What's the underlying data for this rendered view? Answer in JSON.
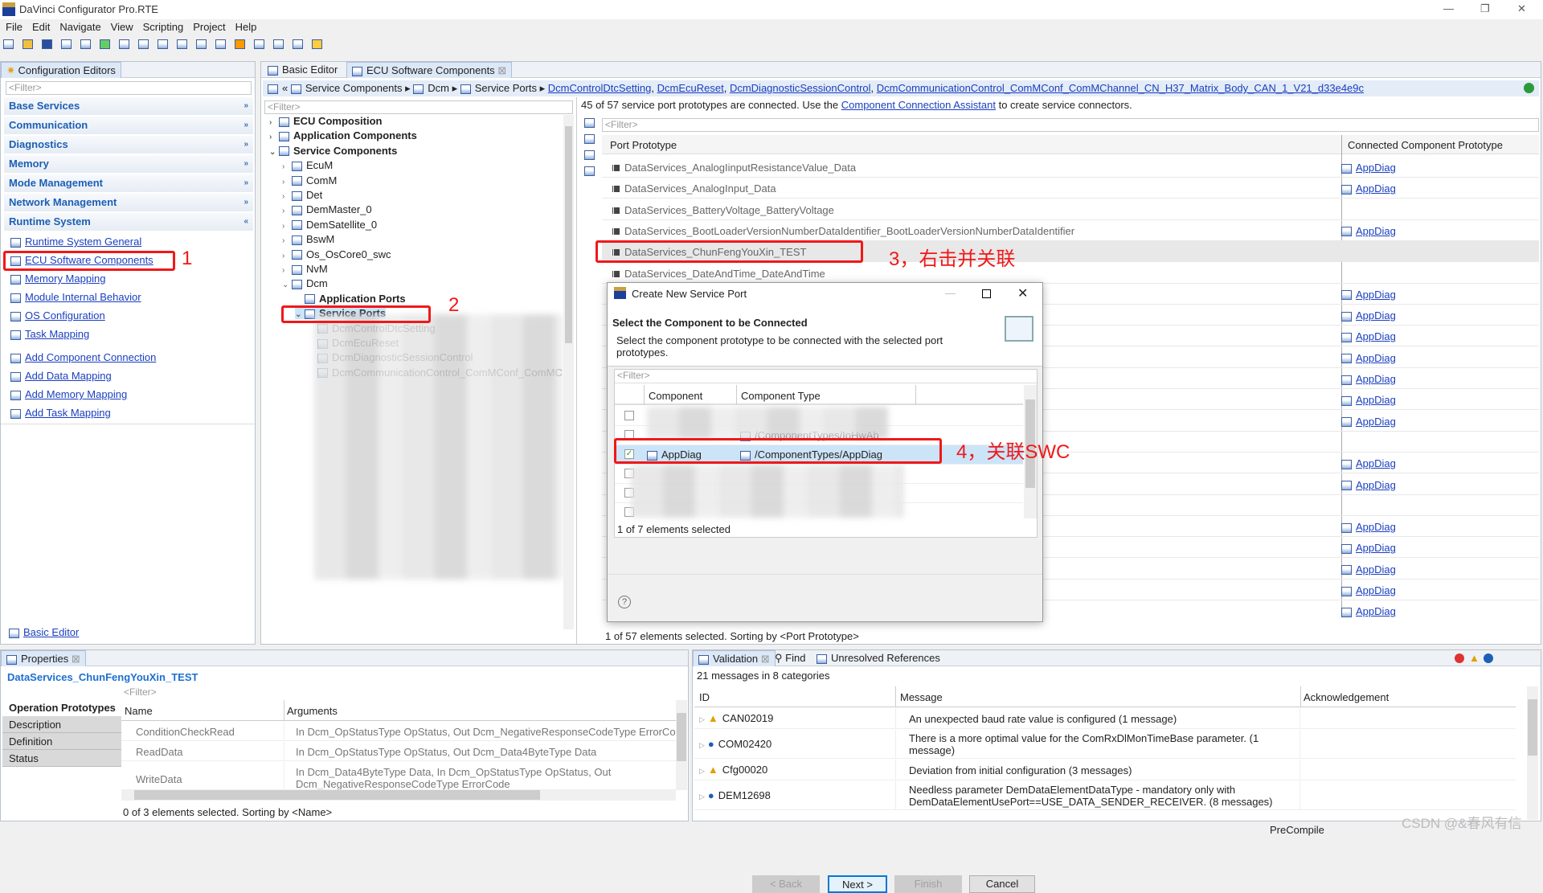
{
  "window": {
    "title": "DaVinci Configurator Pro.RTE",
    "controls": [
      "—",
      "❐",
      "✕"
    ]
  },
  "menu": [
    "File",
    "Edit",
    "Navigate",
    "View",
    "Scripting",
    "Project",
    "Help"
  ],
  "left": {
    "tab": "Configuration Editors",
    "filter": "<Filter>",
    "categories": [
      "Base Services",
      "Communication",
      "Diagnostics",
      "Memory",
      "Mode Management",
      "Network Management",
      "Runtime System"
    ],
    "links": [
      "Runtime System General",
      "ECU Software Components",
      "Memory Mapping",
      "Module Internal Behavior",
      "OS Configuration",
      "Task Mapping",
      "Add Component Connection",
      "Add Data Mapping",
      "Add Memory Mapping",
      "Add Task Mapping"
    ],
    "footer_link": "Basic Editor"
  },
  "editor_tabs": [
    "Basic Editor",
    "ECU Software Components"
  ],
  "breadcrumb": {
    "items": [
      "Service Components",
      "Dcm",
      "Service Ports"
    ],
    "links": [
      "DcmControlDtcSetting",
      "DcmEcuReset",
      "DcmDiagnosticSessionControl",
      "DcmCommunicationControl_ComMConf_ComMChannel_CN_H37_Matrix_Body_CAN_1_V21_d33e4e9c"
    ]
  },
  "tree": {
    "filter": "<Filter>",
    "items": [
      {
        "label": "ECU Composition",
        "level": 0,
        "bold": true,
        "exp": ">"
      },
      {
        "label": "Application Components",
        "level": 0,
        "bold": true,
        "exp": ">"
      },
      {
        "label": "Service Components",
        "level": 0,
        "bold": true,
        "exp": "v"
      },
      {
        "label": "EcuM",
        "level": 1,
        "exp": ">"
      },
      {
        "label": "ComM",
        "level": 1,
        "exp": ">"
      },
      {
        "label": "Det",
        "level": 1,
        "exp": ">"
      },
      {
        "label": "DemMaster_0",
        "level": 1,
        "exp": ">"
      },
      {
        "label": "DemSatellite_0",
        "level": 1,
        "exp": ">"
      },
      {
        "label": "BswM",
        "level": 1,
        "exp": ">"
      },
      {
        "label": "Os_OsCore0_swc",
        "level": 1,
        "exp": ">"
      },
      {
        "label": "NvM",
        "level": 1,
        "exp": ">"
      },
      {
        "label": "Dcm",
        "level": 1,
        "exp": "v"
      },
      {
        "label": "Application Ports",
        "level": 2,
        "bold": true,
        "exp": ""
      },
      {
        "label": "Service Ports",
        "level": 2,
        "bold": true,
        "exp": "v",
        "selected": true
      },
      {
        "label": "DcmControlDtcSetting",
        "level": 3,
        "exp": ""
      },
      {
        "label": "DcmEcuReset",
        "level": 3,
        "exp": ""
      },
      {
        "label": "DcmDiagnosticSessionControl",
        "level": 3,
        "exp": ""
      },
      {
        "label": "DcmCommunicationControl_ComMConf_ComMC",
        "level": 3,
        "exp": ""
      }
    ]
  },
  "ports": {
    "info_pre": "45 of 57 service port prototypes are connected. Use the ",
    "info_link": "Component Connection Assistant",
    "info_post": " to create service connectors.",
    "filter": "<Filter>",
    "col_port": "Port Prototype",
    "col_conn": "Connected Component Prototype",
    "rows": [
      {
        "name": "DataServices_AnalogIinputResistanceValue_Data",
        "conn": "AppDiag"
      },
      {
        "name": "DataServices_AnalogInput_Data",
        "conn": "AppDiag"
      },
      {
        "name": "DataServices_BatteryVoltage_BatteryVoltage",
        "conn": ""
      },
      {
        "name": "DataServices_BootLoaderVersionNumberDataIdentifier_BootLoaderVersionNumberDataIdentifier",
        "conn": "AppDiag"
      },
      {
        "name": "DataServices_ChunFengYouXin_TEST",
        "conn": "",
        "selected": true
      },
      {
        "name": "DataServices_DateAndTime_DateAndTime",
        "conn": ""
      },
      {
        "name": "",
        "conn": "AppDiag"
      },
      {
        "name": "",
        "conn": "AppDiag"
      },
      {
        "name": "",
        "conn": "AppDiag"
      },
      {
        "name": "",
        "conn": "AppDiag"
      },
      {
        "name": "",
        "conn": "AppDiag"
      },
      {
        "name": "",
        "conn": "AppDiag"
      },
      {
        "name": "",
        "conn": "AppDiag"
      },
      {
        "name": "",
        "conn": ""
      },
      {
        "name": "",
        "conn": "AppDiag"
      },
      {
        "name": "",
        "conn": "AppDiag"
      },
      {
        "name": "",
        "conn": ""
      },
      {
        "name": "",
        "conn": "AppDiag"
      },
      {
        "name": "",
        "conn": "AppDiag"
      },
      {
        "name": "",
        "conn": "AppDiag"
      },
      {
        "name": "",
        "conn": "AppDiag"
      },
      {
        "name": "",
        "conn": "AppDiag"
      }
    ],
    "status": "1 of 57 elements selected. Sorting by <Port Prototype>"
  },
  "dialog": {
    "title": "Create New Service Port",
    "heading": "Select the Component to be Connected",
    "desc": "Select the component prototype to be connected with the selected port prototypes.",
    "filter": "<Filter>",
    "col_component": "Component",
    "col_type": "Component Type",
    "rows": [
      {
        "checked": false,
        "component": "",
        "type": ""
      },
      {
        "checked": false,
        "component": "",
        "type": "/ComponentTypes/IoHwAb"
      },
      {
        "checked": true,
        "component": "AppDiag",
        "type": "/ComponentTypes/AppDiag"
      },
      {
        "checked": false,
        "component": "",
        "type": ""
      },
      {
        "checked": false,
        "component": "",
        "type": ""
      },
      {
        "checked": false,
        "component": "",
        "type": ""
      }
    ],
    "status": "1 of 7 elements selected",
    "buttons": {
      "back": "< Back",
      "next": "Next >",
      "finish": "Finish",
      "cancel": "Cancel"
    }
  },
  "annotations": [
    "1",
    "2",
    "3，右击并关联",
    "4，关联SWC"
  ],
  "properties": {
    "tab": "Properties",
    "title": "DataServices_ChunFengYouXin_TEST",
    "filter": "<Filter>",
    "side_tabs": [
      "Operation Prototypes",
      "Description",
      "Definition",
      "Status"
    ],
    "col_name": "Name",
    "col_args": "Arguments",
    "rows": [
      {
        "name": "ConditionCheckRead",
        "args": "In Dcm_OpStatusType OpStatus, Out Dcm_NegativeResponseCodeType ErrorCode"
      },
      {
        "name": "ReadData",
        "args": "In Dcm_OpStatusType OpStatus, Out Dcm_Data4ByteType Data"
      },
      {
        "name": "WriteData",
        "args": "In Dcm_Data4ByteType Data, In Dcm_OpStatusType OpStatus, Out Dcm_NegativeResponseCodeType ErrorCode"
      }
    ],
    "status": "0 of 3 elements selected. Sorting by <Name>"
  },
  "validation": {
    "tabs": [
      "Validation",
      "Find",
      "Unresolved References"
    ],
    "summary": "21 messages in 8 categories",
    "col_id": "ID",
    "col_msg": "Message",
    "col_ack": "Acknowledgement",
    "rows": [
      {
        "id": "CAN02019",
        "icon": "warning",
        "msg": "An unexpected baud rate value is configured (1 message)"
      },
      {
        "id": "COM02420",
        "icon": "info",
        "msg": "There is a more optimal value for the ComRxDlMonTimeBase parameter. (1 message)"
      },
      {
        "id": "Cfg00020",
        "icon": "warning",
        "msg": "Deviation from initial configuration (3 messages)"
      },
      {
        "id": "DEM12698",
        "icon": "info",
        "msg": "Needless parameter DemDataElementDataType - mandatory only with DemDataElementUsePort==USE_DATA_SENDER_RECEIVER. (8 messages)"
      }
    ]
  },
  "statusbar": {
    "mode": "PreCompile"
  },
  "watermark": "CSDN @&春风有信",
  "colors": {
    "accent": "#1d5fb5",
    "annotation": "#f0181a",
    "selection": "#cce4f7"
  }
}
